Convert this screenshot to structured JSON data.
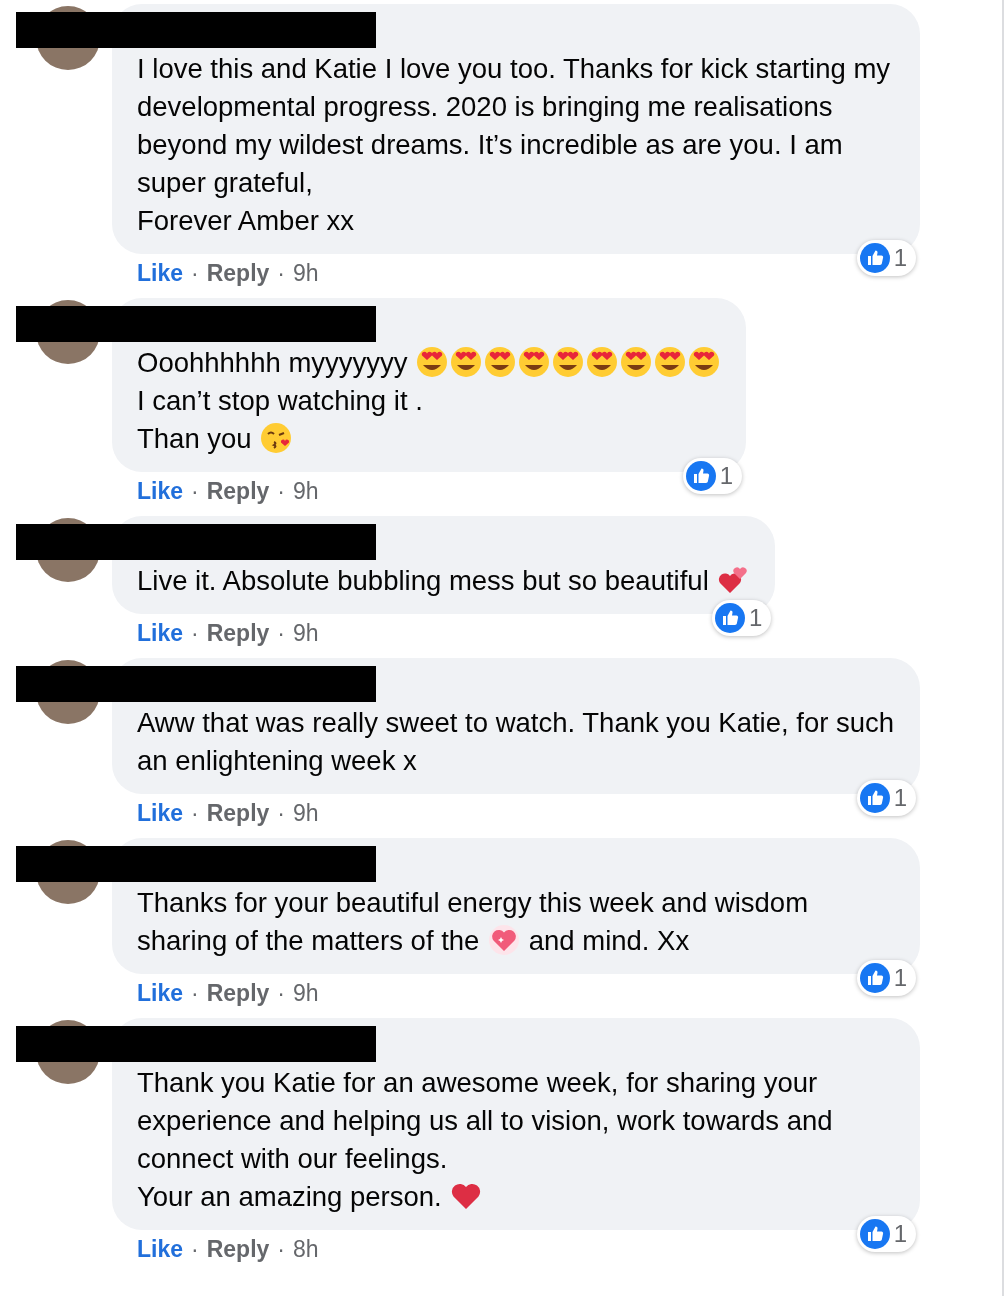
{
  "separator": "·",
  "comments": [
    {
      "paragraphs": [
        [
          {
            "kind": "text",
            "text": "I love this and Katie I love you too. Thanks for kick starting my developmental progress. 2020 is bringing me realisations beyond my wildest dreams. It’s incredible as are you. I am super grateful,"
          }
        ],
        [
          {
            "kind": "text",
            "text": "Forever Amber xx"
          }
        ]
      ],
      "like": "Like",
      "reply": "Reply",
      "time": "9h",
      "reaction_count": "1"
    },
    {
      "paragraphs": [
        [
          {
            "kind": "text",
            "text": "Ooohhhhhh myyyyyyy "
          },
          {
            "kind": "hearteyes"
          },
          {
            "kind": "hearteyes"
          },
          {
            "kind": "hearteyes"
          },
          {
            "kind": "hearteyes"
          },
          {
            "kind": "hearteyes"
          },
          {
            "kind": "hearteyes"
          },
          {
            "kind": "hearteyes"
          },
          {
            "kind": "hearteyes"
          },
          {
            "kind": "hearteyes"
          }
        ],
        [
          {
            "kind": "text",
            "text": "I can’t stop watching it ."
          }
        ],
        [
          {
            "kind": "text",
            "text": "Than you "
          },
          {
            "kind": "kiss"
          }
        ]
      ],
      "like": "Like",
      "reply": "Reply",
      "time": "9h",
      "reaction_count": "1"
    },
    {
      "paragraphs": [
        [
          {
            "kind": "text",
            "text": "Live it. Absolute bubbling mess but so beautiful "
          },
          {
            "kind": "twohearts"
          }
        ]
      ],
      "like": "Like",
      "reply": "Reply",
      "time": "9h",
      "reaction_count": "1"
    },
    {
      "paragraphs": [
        [
          {
            "kind": "text",
            "text": "Aww that was really sweet to watch. Thank you Katie, for such an enlightening week x"
          }
        ]
      ],
      "like": "Like",
      "reply": "Reply",
      "time": "9h",
      "reaction_count": "1"
    },
    {
      "paragraphs": [
        [
          {
            "kind": "text",
            "text": "Thanks for your beautiful energy this week and wisdom sharing of the matters of the "
          },
          {
            "kind": "sparkleheart"
          },
          {
            "kind": "text",
            "text": " and mind. Xx"
          }
        ]
      ],
      "like": "Like",
      "reply": "Reply",
      "time": "9h",
      "reaction_count": "1"
    },
    {
      "paragraphs": [
        [
          {
            "kind": "text",
            "text": "Thank you Katie for an awesome week, for sharing your experience and helping us all to vision, work towards and connect with our feelings."
          }
        ],
        [
          {
            "kind": "text",
            "text": "Your an amazing person. "
          },
          {
            "kind": "heart"
          }
        ]
      ],
      "like": "Like",
      "reply": "Reply",
      "time": "8h",
      "reaction_count": "1"
    }
  ]
}
